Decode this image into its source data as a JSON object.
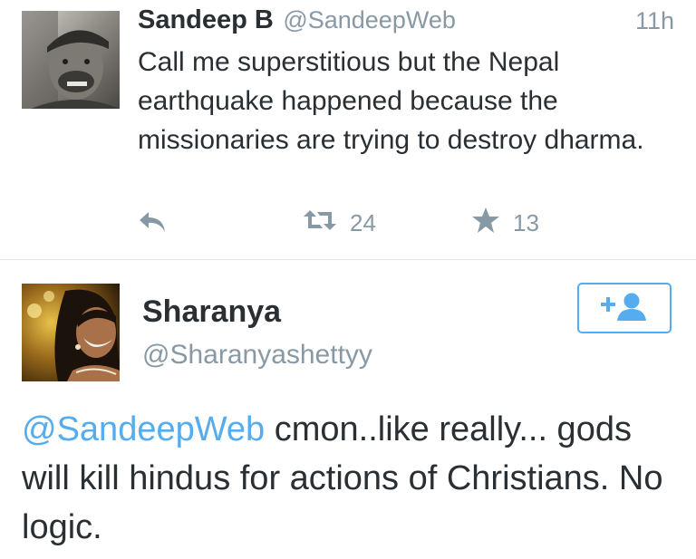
{
  "tweets": [
    {
      "display_name": "Sandeep B",
      "handle": "@SandeepWeb",
      "timestamp": "11h",
      "text": "Call me superstitious but the Nepal earthquake happened because the missionaries are trying to destroy dharma.",
      "retweet_count": "24",
      "favorite_count": "13"
    },
    {
      "display_name": "Sharanya",
      "handle": "@Sharanyashettyy",
      "mention": "@SandeepWeb",
      "text": " cmon..like really... gods will kill hindus for actions of Christians. No logic."
    }
  ],
  "colors": {
    "accent": "#55acee",
    "muted": "#8899a6",
    "text": "#292f33",
    "divider": "#e1e8ed"
  },
  "icons": {
    "reply": "reply-icon",
    "retweet": "retweet-icon",
    "favorite": "star-icon",
    "follow": "follow-user-icon"
  }
}
